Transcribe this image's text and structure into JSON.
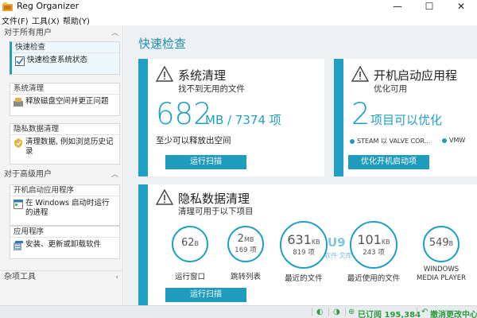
{
  "window": {
    "title": "Reg Organizer",
    "minimize": "—",
    "maximize": "☐",
    "close": "✕"
  },
  "menu": [
    "文件(F)",
    "工具(X)",
    "帮助(Y)"
  ],
  "sidebar": {
    "all_users_header": "对于所有用户",
    "advanced_users_header": "对于高级用户",
    "misc_header": "杂项工具",
    "items": [
      {
        "title": "快速检查",
        "body": "快速检查系统状态",
        "icon": "check-icon"
      },
      {
        "title": "系统清理",
        "body": "释放磁盘空间并更正问题",
        "icon": "disk-cleanup-icon"
      },
      {
        "title": "隐私数据清理",
        "body": "清理数据, 例如浏览历史记录",
        "icon": "privacy-icon"
      },
      {
        "title": "开机启动应用程序",
        "body": "在 Windows 启动时运行的进程",
        "icon": "startup-icon"
      },
      {
        "title": "应用程序",
        "body": "安装、更新或卸载软件",
        "icon": "apps-icon"
      }
    ]
  },
  "main": {
    "title": "快速检查",
    "system_cleanup": {
      "title": "系统清理",
      "subtitle": "找不到无用的文件",
      "big_value": "682",
      "unit": "MB / 7374 项",
      "note": "至少可以释放出空间",
      "button": "运行扫描"
    },
    "startup": {
      "title": "开机启动应用程",
      "subtitle": "优化可用",
      "big_value": "2",
      "unit": "项目可以优化",
      "tags": [
        "STEAM 以 VALVE COR...",
        "VMW"
      ],
      "button": "优化开机启动项"
    },
    "privacy": {
      "title": "隐私数据清理",
      "subtitle": "清理可用于以下项目",
      "button": "运行扫描",
      "circles": [
        {
          "big": "62",
          "unit": "B",
          "small": "",
          "label": "运行窗口"
        },
        {
          "big": "2",
          "unit": "MB",
          "small": "169 项",
          "label": "跳转列表"
        },
        {
          "big": "631",
          "unit": "KB",
          "small": "819 项",
          "label": "最近的文件"
        },
        {
          "big": "101",
          "unit": "KB",
          "small": "243 项",
          "label": "最近使用的文件"
        },
        {
          "big": "549",
          "unit": "B",
          "small": "",
          "label": "WINDOWS MEDIA PLAYER"
        }
      ]
    },
    "watermark": "U9",
    "watermark_sub": "软件·文库"
  },
  "statusbar": {
    "subscribed": "已订阅 195,384",
    "undo": "撤消更改中心"
  },
  "colors": {
    "accent": "#1fa0c4",
    "status_green": "#2e9a3f"
  }
}
